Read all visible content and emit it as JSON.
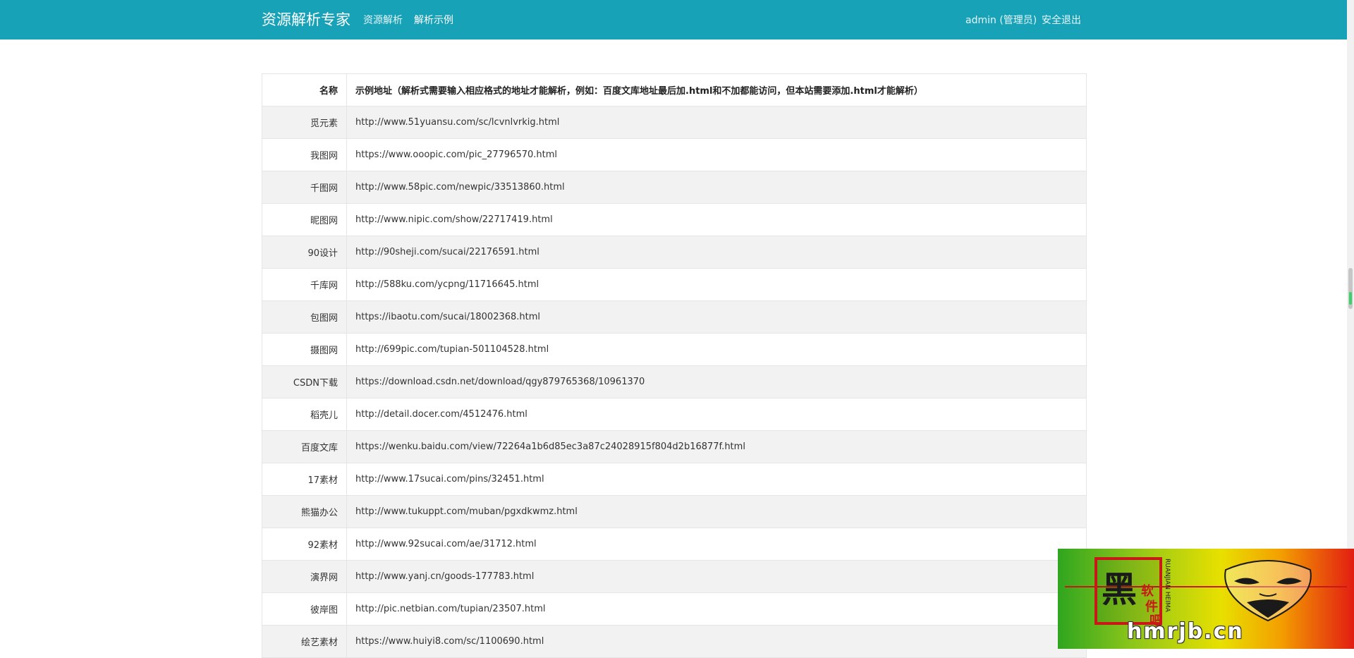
{
  "navbar": {
    "brand": "资源解析专家",
    "links": [
      "资源解析",
      "解析示例"
    ],
    "user": "admin (管理员)",
    "logout": "安全退出",
    "color": "#17a2b8"
  },
  "table": {
    "headers": {
      "name": "名称",
      "url": "示例地址（解析式需要输入相应格式的地址才能解析，例如：百度文库地址最后加.html和不加都能访问，但本站需要添加.html才能解析）"
    },
    "rows": [
      {
        "name": "觅元素",
        "url": "http://www.51yuansu.com/sc/lcvnlvrkig.html"
      },
      {
        "name": "我图网",
        "url": "https://www.ooopic.com/pic_27796570.html"
      },
      {
        "name": "千图网",
        "url": "http://www.58pic.com/newpic/33513860.html"
      },
      {
        "name": "昵图网",
        "url": "http://www.nipic.com/show/22717419.html"
      },
      {
        "name": "90设计",
        "url": "http://90sheji.com/sucai/22176591.html"
      },
      {
        "name": "千库网",
        "url": "http://588ku.com/ycpng/11716645.html"
      },
      {
        "name": "包图网",
        "url": "https://ibaotu.com/sucai/18002368.html"
      },
      {
        "name": "摄图网",
        "url": "http://699pic.com/tupian-501104528.html"
      },
      {
        "name": "CSDN下载",
        "url": "https://download.csdn.net/download/qgy879765368/10961370"
      },
      {
        "name": "稻壳儿",
        "url": "http://detail.docer.com/4512476.html"
      },
      {
        "name": "百度文库",
        "url": "https://wenku.baidu.com/view/72264a1b6d85ec3a87c24028915f804d2b16877f.html"
      },
      {
        "name": "17素材",
        "url": "http://www.17sucai.com/pins/32451.html"
      },
      {
        "name": "熊猫办公",
        "url": "http://www.tukuppt.com/muban/pgxdkwmz.html"
      },
      {
        "name": "92素材",
        "url": "http://www.92sucai.com/ae/31712.html"
      },
      {
        "name": "演界网",
        "url": "http://www.yanj.cn/goods-177783.html"
      },
      {
        "name": "彼岸图",
        "url": "http://pic.netbian.com/tupian/23507.html"
      },
      {
        "name": "绘艺素材",
        "url": "https://www.huiyi8.com/sc/1100690.html"
      }
    ]
  },
  "watermark": {
    "seal_chars": [
      "黑",
      "软",
      "件",
      "吧"
    ],
    "vertical": "RUANJIAN HEIMA",
    "domain": "hmrjb.cn"
  }
}
